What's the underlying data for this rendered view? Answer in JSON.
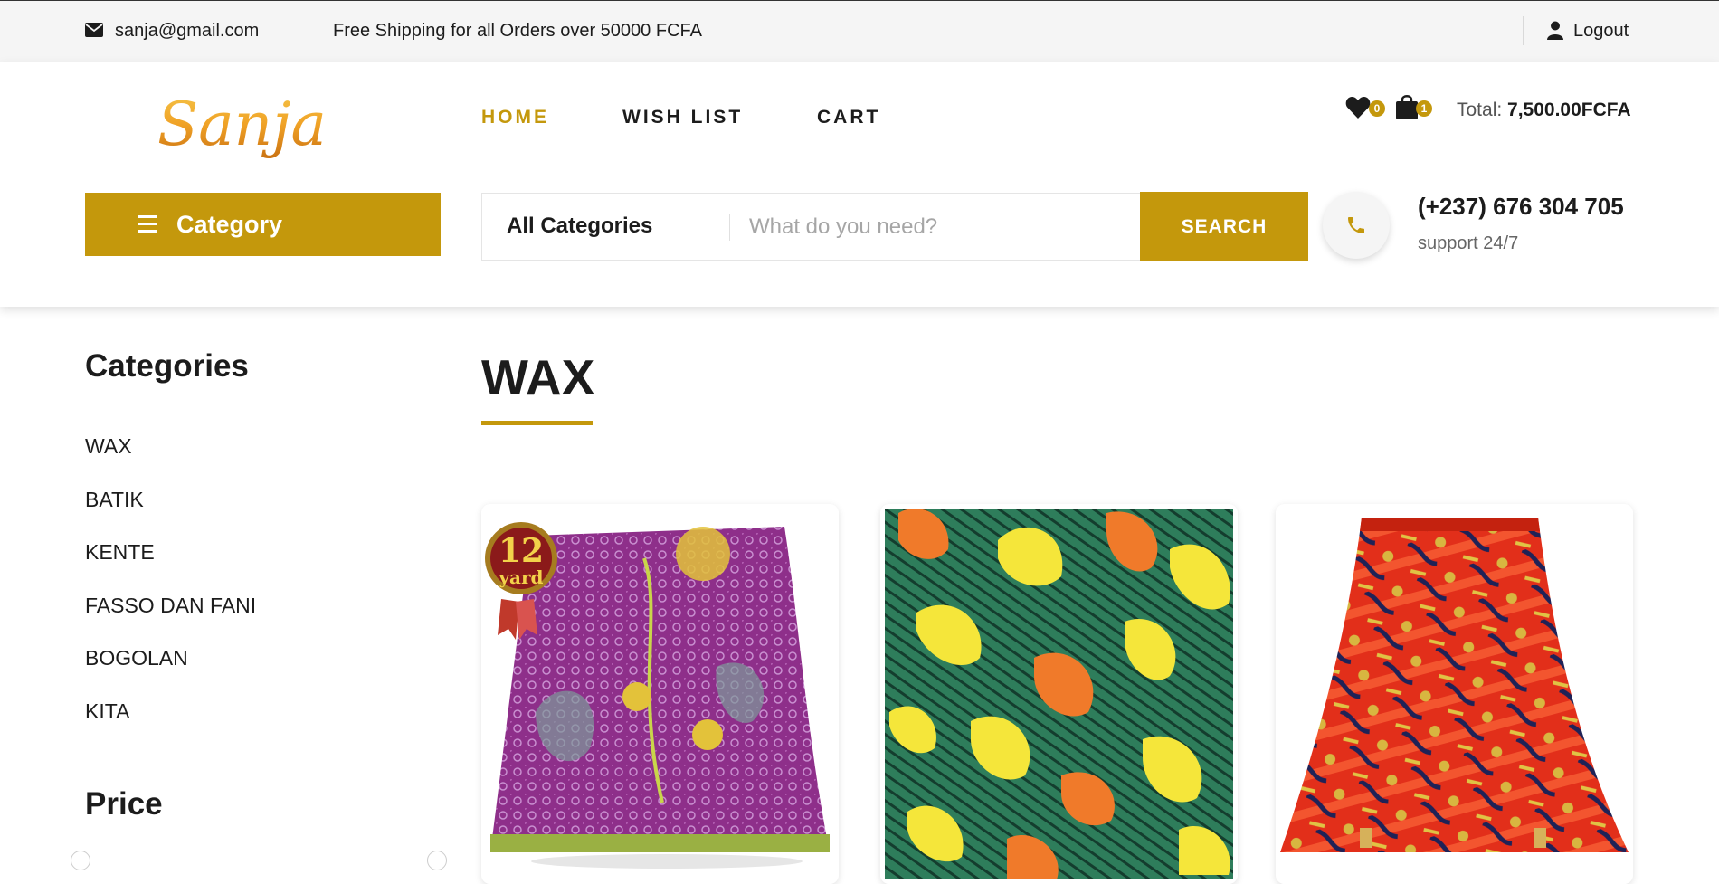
{
  "topbar": {
    "email": "sanja@gmail.com",
    "shipping": "Free Shipping for all Orders over 50000 FCFA",
    "logout": "Logout"
  },
  "header": {
    "logo_text": "Sanja",
    "nav": [
      {
        "label": "HOME",
        "active": true
      },
      {
        "label": "WISH LIST",
        "active": false
      },
      {
        "label": "CART",
        "active": false
      }
    ],
    "wishlist_count": "0",
    "cart_count": "1",
    "total_label": "Total: ",
    "total_value": "7,500.00FCFA",
    "category_button": "Category",
    "search_category": "All Categories",
    "search_placeholder": "What do you need?",
    "search_button": "SEARCH",
    "phone": "(+237) 676 304 705",
    "support": "support 24/7"
  },
  "sidebar": {
    "categories_title": "Categories",
    "categories": [
      "WAX",
      "BATIK",
      "KENTE",
      "FASSO DAN FANI",
      "BOGOLAN",
      "KITA"
    ],
    "price_title": "Price"
  },
  "main": {
    "title": "WAX",
    "badge_number": "12",
    "badge_unit": "yard"
  },
  "colors": {
    "accent": "#c4980c",
    "topbar_bg": "#f5f5f5",
    "text": "#1c1c1c"
  }
}
